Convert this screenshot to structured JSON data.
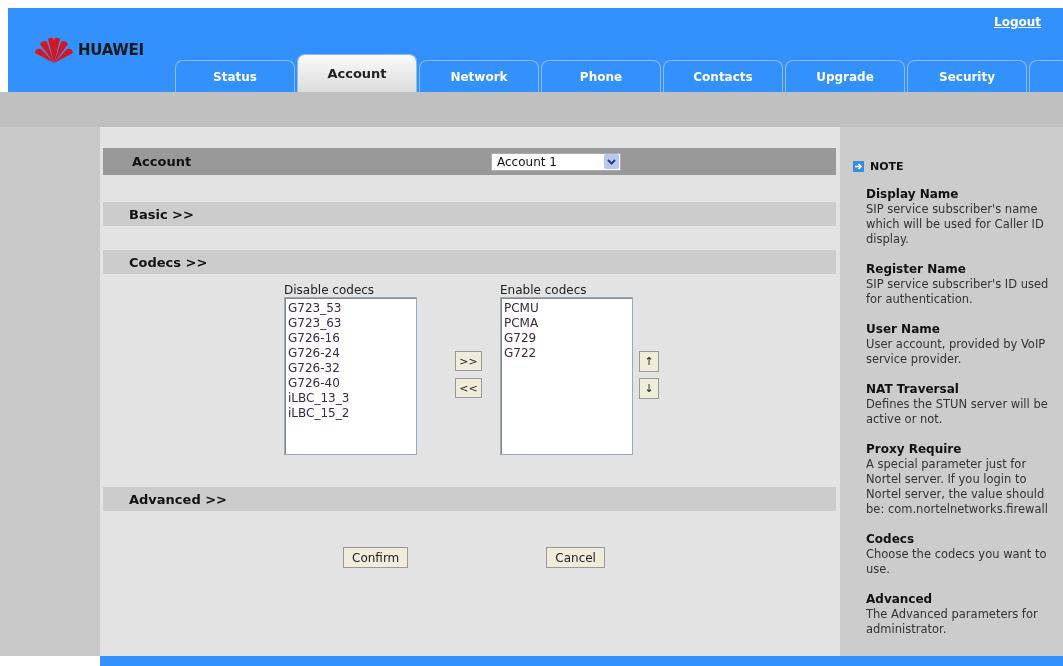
{
  "header": {
    "logout": "Logout",
    "brand": "HUAWEI"
  },
  "tabs": [
    {
      "label": "Status",
      "selected": false
    },
    {
      "label": "Account",
      "selected": true
    },
    {
      "label": "Network",
      "selected": false
    },
    {
      "label": "Phone",
      "selected": false
    },
    {
      "label": "Contacts",
      "selected": false
    },
    {
      "label": "Upgrade",
      "selected": false
    },
    {
      "label": "Security",
      "selected": false
    }
  ],
  "account": {
    "label": "Account",
    "value": "Account 1"
  },
  "sections": [
    {
      "title": "Basic >>"
    },
    {
      "title": "Codecs >>"
    }
  ],
  "codecs": {
    "disabled_label": "Disable codecs",
    "disabled": [
      "G723_53",
      "G723_63",
      "G726-16",
      "G726-24",
      "G726-32",
      "G726-40",
      "iLBC_13_3",
      "iLBC_15_2"
    ],
    "enabled_label": "Enable codecs",
    "enabled": [
      "PCMU",
      "PCMA",
      "G729",
      "G722"
    ],
    "add": ">>",
    "remove": "<<",
    "up": "↑",
    "down": "↓"
  },
  "advanced": {
    "title": "Advanced >>"
  },
  "buttons": [
    "Confirm",
    "Cancel"
  ],
  "note": {
    "title": "NOTE",
    "items": [
      {
        "term": "Display Name",
        "text": "SIP service subscriber's name which will be used for Caller ID display."
      },
      {
        "term": "Register Name",
        "text": "SIP service subscriber's ID used for authentication."
      },
      {
        "term": "User Name",
        "text": "User account, provided by VoIP service provider."
      },
      {
        "term": "NAT Traversal",
        "text": "Defines the STUN server will be active or not."
      },
      {
        "term": "Proxy Require",
        "text": "A special parameter just for Nortel server. If you login to Nortel server, the value should be: com.nortelnetworks.firewall"
      },
      {
        "term": "Codecs",
        "text": "Choose the codecs you want to use."
      },
      {
        "term": "Advanced",
        "text": "The Advanced parameters for administrator."
      }
    ]
  }
}
